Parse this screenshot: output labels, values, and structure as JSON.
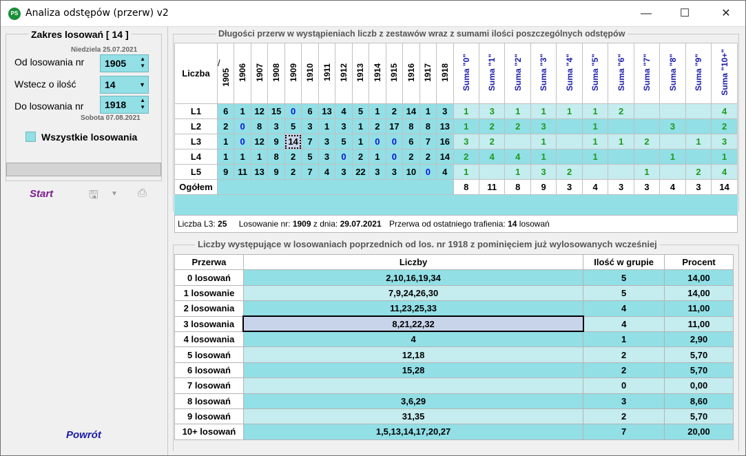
{
  "window": {
    "title": "Analiza odstępów (przerw) v2",
    "icon_text": "PS",
    "min": "—",
    "max": "☐",
    "close": "✕"
  },
  "left": {
    "group_title": "Zakres losowań  [ 14 ]",
    "date_top": "Niedziela 25.07.2021",
    "from_label": "Od losowania nr",
    "from_value": "1905",
    "back_label": "Wstecz o ilość",
    "back_value": "14",
    "to_label": "Do losowania nr",
    "to_value": "1918",
    "date_bottom": "Sobota 07.08.2021",
    "all_label": "Wszystkie losowania",
    "start": "Start",
    "back": "Powrót"
  },
  "top_table": {
    "title": "Długości przerw w wystąpieniach liczb z zestawów wraz z sumami ilości poszczególnych odstępów",
    "corner_label": "Liczba",
    "slash": "/",
    "draws": [
      "1905",
      "1906",
      "1907",
      "1908",
      "1909",
      "1910",
      "1911",
      "1912",
      "1913",
      "1914",
      "1915",
      "1916",
      "1917",
      "1918"
    ],
    "sums": [
      "Suma \"0\"",
      "Suma \"1\"",
      "Suma \"2\"",
      "Suma \"3\"",
      "Suma \"4\"",
      "Suma \"5\"",
      "Suma \"6\"",
      "Suma \"7\"",
      "Suma \"8\"",
      "Suma \"9\"",
      "Suma \"10+\""
    ],
    "rows": [
      {
        "label": "L1",
        "values": [
          "6",
          "1",
          "12",
          "15",
          "0",
          "6",
          "13",
          "4",
          "5",
          "1",
          "2",
          "14",
          "1",
          "3"
        ],
        "sums": [
          "1",
          "3",
          "1",
          "1",
          "1",
          "1",
          "2",
          "",
          "",
          "",
          "4"
        ]
      },
      {
        "label": "L2",
        "values": [
          "2",
          "0",
          "8",
          "3",
          "5",
          "3",
          "1",
          "3",
          "1",
          "2",
          "17",
          "8",
          "8",
          "13"
        ],
        "sums": [
          "1",
          "2",
          "2",
          "3",
          "",
          "1",
          "",
          "",
          "3",
          "",
          "2"
        ]
      },
      {
        "label": "L3",
        "values": [
          "1",
          "0",
          "12",
          "9",
          "14",
          "7",
          "3",
          "5",
          "1",
          "0",
          "0",
          "6",
          "7",
          "16"
        ],
        "sums": [
          "3",
          "2",
          "",
          "1",
          "",
          "1",
          "1",
          "2",
          "",
          "1",
          "3"
        ]
      },
      {
        "label": "L4",
        "values": [
          "1",
          "1",
          "1",
          "8",
          "2",
          "5",
          "3",
          "0",
          "2",
          "1",
          "0",
          "2",
          "2",
          "14"
        ],
        "sums": [
          "2",
          "4",
          "4",
          "1",
          "",
          "1",
          "",
          "",
          "1",
          "",
          "1"
        ]
      },
      {
        "label": "L5",
        "values": [
          "9",
          "11",
          "13",
          "9",
          "2",
          "7",
          "4",
          "3",
          "22",
          "3",
          "3",
          "10",
          "0",
          "4"
        ],
        "sums": [
          "1",
          "",
          "1",
          "3",
          "2",
          "",
          "",
          "1",
          "",
          "2",
          "4"
        ]
      }
    ],
    "total_label": "Ogółem",
    "totals": [
      "8",
      "11",
      "8",
      "9",
      "3",
      "4",
      "3",
      "3",
      "4",
      "3",
      "14"
    ]
  },
  "info": {
    "l_label": "Liczba L3:",
    "l_value": "25",
    "draw_label": "Losowanie nr:",
    "draw_value": "1909",
    "date_label": "z dnia:",
    "date_value": "29.07.2021",
    "gap_label": "Przerwa od ostatniego trafienia:",
    "gap_value": "14",
    "gap_unit": "losowań"
  },
  "bottom_table": {
    "title": "Liczby występujące w losowaniach poprzednich od los. nr 1918 z pominięciem już wylosowanych wcześniej",
    "headers": [
      "Przerwa",
      "Liczby",
      "Ilość w grupie",
      "Procent"
    ],
    "rows": [
      [
        "0 losowań",
        "2,10,16,19,34",
        "5",
        "14,00"
      ],
      [
        "1 losowanie",
        "7,9,24,26,30",
        "5",
        "14,00"
      ],
      [
        "2 losowania",
        "11,23,25,33",
        "4",
        "11,00"
      ],
      [
        "3 losowania",
        "8,21,22,32",
        "4",
        "11,00"
      ],
      [
        "4 losowania",
        "4",
        "1",
        "2,90"
      ],
      [
        "5 losowań",
        "12,18",
        "2",
        "5,70"
      ],
      [
        "6 losowań",
        "15,28",
        "2",
        "5,70"
      ],
      [
        "7 losowań",
        "",
        "0",
        "0,00"
      ],
      [
        "8 losowań",
        "3,6,29",
        "3",
        "8,60"
      ],
      [
        "9 losowań",
        "31,35",
        "2",
        "5,70"
      ],
      [
        "10+ losowań",
        "1,5,13,14,17,20,27",
        "7",
        "20,00"
      ]
    ]
  },
  "colors": {
    "cyan": "#92dfe6",
    "light_cyan": "#c5ecef",
    "blue_zero": "#0a16d6",
    "green_sum": "#1d9a1d"
  }
}
